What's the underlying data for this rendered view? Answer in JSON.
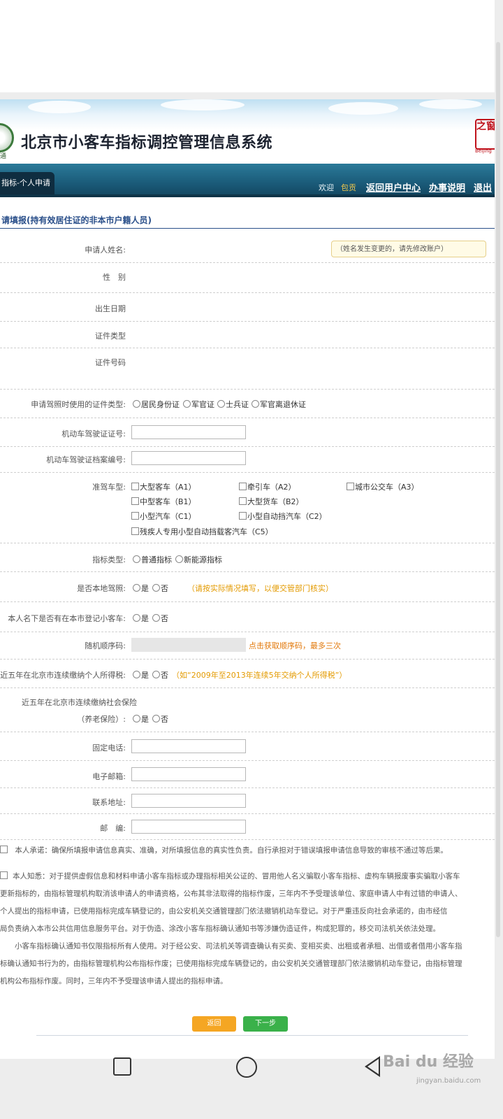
{
  "header": {
    "title": "北京市小客车指标调控管理信息系统",
    "emblem_text": "通",
    "seal_text": "之窗",
    "seal_sub": "Beijing"
  },
  "nav": {
    "tab": "指标-个人申请",
    "welcome": "欢迎",
    "user": "包贡",
    "links": [
      "返回用户中心",
      "办事说明",
      "退出"
    ]
  },
  "form": {
    "section_title": "请填报(持有效居住证的非本市户籍人员)",
    "name_label": "申请人姓名:",
    "name_note": "（姓名发生变更的，请先修改账户）",
    "gender_label": "性　别",
    "birth_label": "出生日期",
    "id_type_label": "证件类型",
    "id_number_label": "证件号码",
    "license_id_type_label": "申请驾照时使用的证件类型:",
    "license_id_options": [
      "居民身份证",
      "军官证",
      "士兵证",
      "军官离退休证"
    ],
    "license_no_label": "机动车驾驶证证号:",
    "license_file_label": "机动车驾驶证档案编号:",
    "vehicle_class_label": "准驾车型:",
    "vehicle_classes": [
      [
        "大型客车（A1）",
        "牵引车（A2）",
        "城市公交车（A3）"
      ],
      [
        "中型客车（B1）",
        "大型货车（B2）"
      ],
      [
        "小型汽车（C1）",
        "小型自动挡汽车（C2）"
      ],
      [
        "残疾人专用小型自动挡载客汽车（C5）"
      ]
    ],
    "quota_type_label": "指标类型:",
    "quota_options": [
      "普通指标",
      "新能源指标"
    ],
    "local_license_label": "是否本地驾照:",
    "yes": "是",
    "no": "否",
    "local_license_note": "（请按实际情况填写，以便交管部门核实）",
    "registered_car_label": "本人名下是否有在本市登记小客车:",
    "seq_label": "随机顺序码:",
    "seq_link": "点击获取顺序码，最多三次",
    "tax_label": "近五年在北京市连续缴纳个人所得税:",
    "tax_note": "（如“2009年至2013年连续5年交纳个人所得税”）",
    "insurance_label_1": "近五年在北京市连续缴纳社会保险",
    "insurance_label_2": "（养老保险）:",
    "phone_label": "固定电话:",
    "email_label": "电子邮箱:",
    "address_label": "联系地址:",
    "postcode_label": "邮　编:"
  },
  "declarations": {
    "promise": "本人承诺：确保所填报申请信息真实、准确，对所填报信息的真实性负责。自行承担对于错误填报申请信息导致的审核不通过等后果。",
    "notice_lines": [
      "本人知悉：对于提供虚假信息和材料申请小客车指标或办理指标相关公证的、冒用他人名义骗取小客车指标、虚构车辆报废事实骗取小客车",
      "更新指标的，由指标管理机构取消该申请人的申请资格，公布其非法取得的指标作废，三年内不予受理该单位、家庭申请人中有过错的申请人、",
      "个人提出的指标申请，已使用指标完成车辆登记的，由公安机关交通管理部门依法撤销机动车登记。对于严重违反向社会承诺的，由市经信",
      "局负责纳入本市公共信用信息服务平台。对于伪造、涂改小客车指标确认通知书等涉嫌伪造证件，构成犯罪的，移交司法机关依法处理。",
      "　　小客车指标确认通知书仅限指标所有人使用。对于经公安、司法机关等调查确认有买卖、变相买卖、出租或者承租、出借或者借用小客车指",
      "标确认通知书行为的，由指标管理机构公布指标作废；已使用指标完成车辆登记的，由公安机关交通管理部门依法撤销机动车登记，由指标管理",
      "机构公布指标作废。同时，三年内不予受理该申请人提出的指标申请。"
    ]
  },
  "buttons": {
    "back": "返回",
    "next": "下一步"
  },
  "colors": {
    "nav_bg": "#1a5a78",
    "section_title": "#2a4f8a",
    "back_button": "#f5a623",
    "next_button": "#3ab14a",
    "note_orange": "#e39a00"
  },
  "watermark": {
    "brand": "Bai du 经验",
    "sub": "jingyan.baidu.com"
  }
}
